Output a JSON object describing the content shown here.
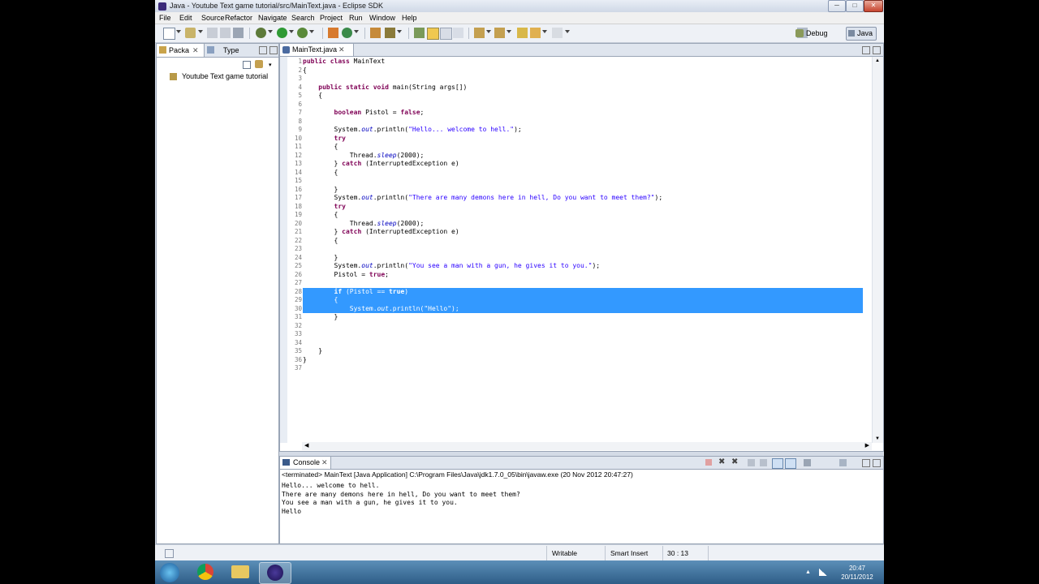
{
  "window": {
    "title": "Java - Youtube Text game tutorial/src/MainText.java - Eclipse SDK"
  },
  "menu": [
    "File",
    "Edit",
    "Source",
    "Refactor",
    "Navigate",
    "Search",
    "Project",
    "Run",
    "Window",
    "Help"
  ],
  "perspectives": {
    "debug": "Debug",
    "java": "Java"
  },
  "left_panel": {
    "tabs": [
      {
        "label": "Packa"
      },
      {
        "label": "Type"
      }
    ],
    "tree_items": [
      "Youtube Text game tutorial"
    ]
  },
  "editor": {
    "tab_label": "MainText.java",
    "selected_lines": [
      28,
      29,
      30
    ],
    "lines": [
      [
        [
          "kw",
          "public class "
        ],
        [
          "",
          "MainText"
        ]
      ],
      [
        [
          "",
          "{"
        ]
      ],
      [],
      [
        [
          "",
          "    "
        ],
        [
          "kw",
          "public static void "
        ],
        [
          "",
          "main(String args[])"
        ]
      ],
      [
        [
          "",
          "    {"
        ]
      ],
      [],
      [
        [
          "",
          "        "
        ],
        [
          "kw",
          "boolean "
        ],
        [
          "",
          "Pistol = "
        ],
        [
          "kw",
          "false"
        ],
        [
          "",
          ";"
        ]
      ],
      [],
      [
        [
          "",
          "        System."
        ],
        [
          "it",
          "out"
        ],
        [
          "",
          ".println("
        ],
        [
          "str",
          "\"Hello... welcome to hell.\""
        ],
        [
          "",
          ");"
        ]
      ],
      [
        [
          "",
          "        "
        ],
        [
          "kw",
          "try"
        ]
      ],
      [
        [
          "",
          "        {"
        ]
      ],
      [
        [
          "",
          "            Thread."
        ],
        [
          "it",
          "sleep"
        ],
        [
          "",
          "(2000);"
        ]
      ],
      [
        [
          "",
          "        } "
        ],
        [
          "kw",
          "catch "
        ],
        [
          "",
          "(InterruptedException e)"
        ]
      ],
      [
        [
          "",
          "        {"
        ]
      ],
      [],
      [
        [
          "",
          "        }"
        ]
      ],
      [
        [
          "",
          "        System."
        ],
        [
          "it",
          "out"
        ],
        [
          "",
          ".println("
        ],
        [
          "str",
          "\"There are many demons here in hell, Do you want to meet them?\""
        ],
        [
          "",
          ");"
        ]
      ],
      [
        [
          "",
          "        "
        ],
        [
          "kw",
          "try"
        ]
      ],
      [
        [
          "",
          "        {"
        ]
      ],
      [
        [
          "",
          "            Thread."
        ],
        [
          "it",
          "sleep"
        ],
        [
          "",
          "(2000);"
        ]
      ],
      [
        [
          "",
          "        } "
        ],
        [
          "kw",
          "catch "
        ],
        [
          "",
          "(InterruptedException e)"
        ]
      ],
      [
        [
          "",
          "        {"
        ]
      ],
      [],
      [
        [
          "",
          "        }"
        ]
      ],
      [
        [
          "",
          "        System."
        ],
        [
          "it",
          "out"
        ],
        [
          "",
          ".println("
        ],
        [
          "str",
          "\"You see a man with a gun, he gives it to you.\""
        ],
        [
          "",
          ");"
        ]
      ],
      [
        [
          "",
          "        Pistol = "
        ],
        [
          "kw",
          "true"
        ],
        [
          "",
          ";"
        ]
      ],
      [],
      [
        [
          "",
          "        "
        ],
        [
          "kw",
          "if "
        ],
        [
          "",
          "(Pistol == "
        ],
        [
          "kw",
          "true"
        ],
        [
          "",
          ")"
        ]
      ],
      [
        [
          "",
          "        {"
        ]
      ],
      [
        [
          "",
          "            System."
        ],
        [
          "it",
          "out"
        ],
        [
          "",
          ".println("
        ],
        [
          "str",
          "\"Hello\""
        ],
        [
          "",
          ");"
        ]
      ],
      [
        [
          "",
          "        }"
        ]
      ],
      [],
      [],
      [],
      [
        [
          "",
          "    }"
        ]
      ],
      [
        [
          "",
          "}"
        ]
      ],
      []
    ]
  },
  "console": {
    "tab_label": "Console",
    "status": "<terminated> MainText [Java Application] C:\\Program Files\\Java\\jdk1.7.0_05\\bin\\javaw.exe (20 Nov 2012 20:47:27)",
    "output": [
      "Hello... welcome to hell.",
      "There are many demons here in hell, Do you want to meet them?",
      "You see a man with a gun, he gives it to you.",
      "Hello"
    ]
  },
  "statusbar": {
    "mode": "Writable",
    "insert": "Smart Insert",
    "position": "30 : 13"
  },
  "taskbar": {
    "time": "20:47",
    "date": "20/11/2012"
  }
}
